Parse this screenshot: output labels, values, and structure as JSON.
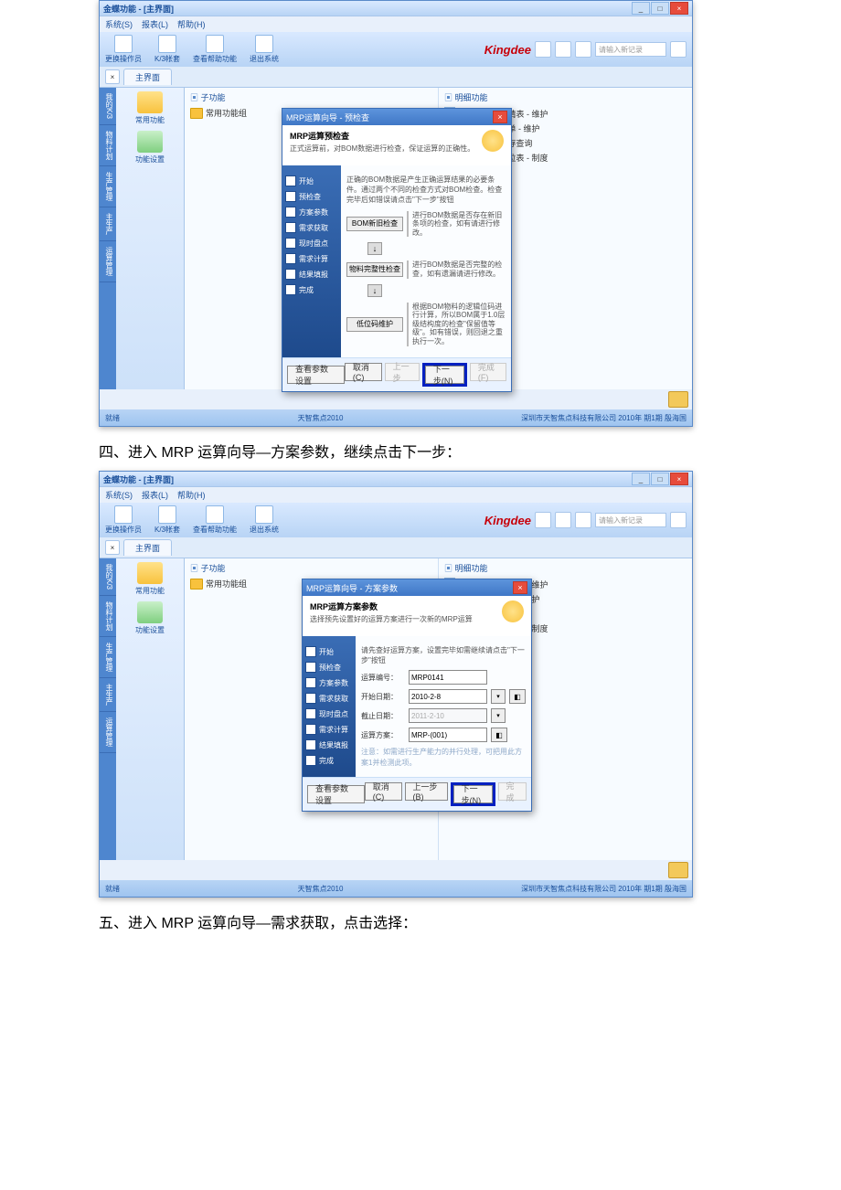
{
  "steps": {
    "four": "四、进入 MRP 运算向导—方案参数，继续点击下一步：",
    "five": "五、进入 MRP 运算向导—需求获取，点击选择："
  },
  "app": {
    "title": "金蝶功能 - [主界面]",
    "menu": [
      "系统(S)",
      "报表(L)",
      "帮助(H)"
    ],
    "toolbar": [
      "更换操作员",
      "K/3帐套",
      "查看帮助功能",
      "退出系统"
    ],
    "brand": "Kingdee",
    "search_ph": "请输入新记录",
    "tab": "主界面",
    "sidetabs": [
      "我的K/3",
      "物料计划",
      "生产管理",
      "主生产",
      "运算管理"
    ],
    "left": [
      "常用功能",
      "功能设置"
    ],
    "col1_head": "子功能",
    "col1_item": "常用功能组",
    "col2_head": "明细功能",
    "col2_items": [
      "18009  预测申请表 - 维护",
      "18013  采购订单 - 维护",
      "19043  即时库存查询",
      "19015  物料清位表 - 制度"
    ],
    "footer_center": "天智焦点2010",
    "footer_right": "深圳市天智焦点科技有限公司   2010年 期1期      殷海国",
    "footer_left": "就绪"
  },
  "dlg1": {
    "title": "MRP运算向导 - 预检查",
    "head": "MRP运算预检查",
    "sub": "正式运算前，对BOM数据进行检查，保证运算的正确性。",
    "note": "正确的BOM数据是产生正确运算结果的必要条件。通过两个不同的检查方式对BOM检查。检查完毕后如错误请点击\"下一步\"按钮",
    "steps": [
      "开始",
      "预检查",
      "方案参数",
      "需求获取",
      "现时盘点",
      "需求计算",
      "结果填报",
      "完成"
    ],
    "check1_btn": "BOM新旧检查",
    "check1_txt": "进行BOM数据是否存在新旧条项的检查，如有请进行修改。",
    "check2_btn": "物料完整性检查",
    "check2_txt": "进行BOM数据是否完整的检查，如有遗漏请进行修改。",
    "check3_btn": "低位码维护",
    "check3_txt": "根据BOM物料的逻辑位码进行计算，所以BOM属于1.0层级结构度的检查\"保留值等级\"。如有错误，则回退之重执行一次。",
    "btns": {
      "view": "查看参数设置",
      "cancel": "取消(C)",
      "prev": "上一步",
      "next": "下一步(N)",
      "finish": "完成(F)"
    }
  },
  "dlg2": {
    "title": "MRP运算向导 - 方案参数",
    "head": "MRP运算方案参数",
    "sub": "选择预先设置好的运算方案进行一次新的MRP运算",
    "note": "请先查好运算方案，设置完毕如需继续请点击\"下一步\"按钮",
    "f_plan_no": "运算编号：",
    "f_plan_no_v": "MRP0141",
    "f_start": "开始日期：",
    "f_start_v": "2010-2-8",
    "f_end": "截止日期：",
    "f_end_v": "2011-2-10",
    "f_scheme": "运算方案：",
    "f_scheme_v": "MRP-(001)",
    "hint": "注意：如需进行生产能力的并行处理，可把用此方案1并检测此项。"
  }
}
